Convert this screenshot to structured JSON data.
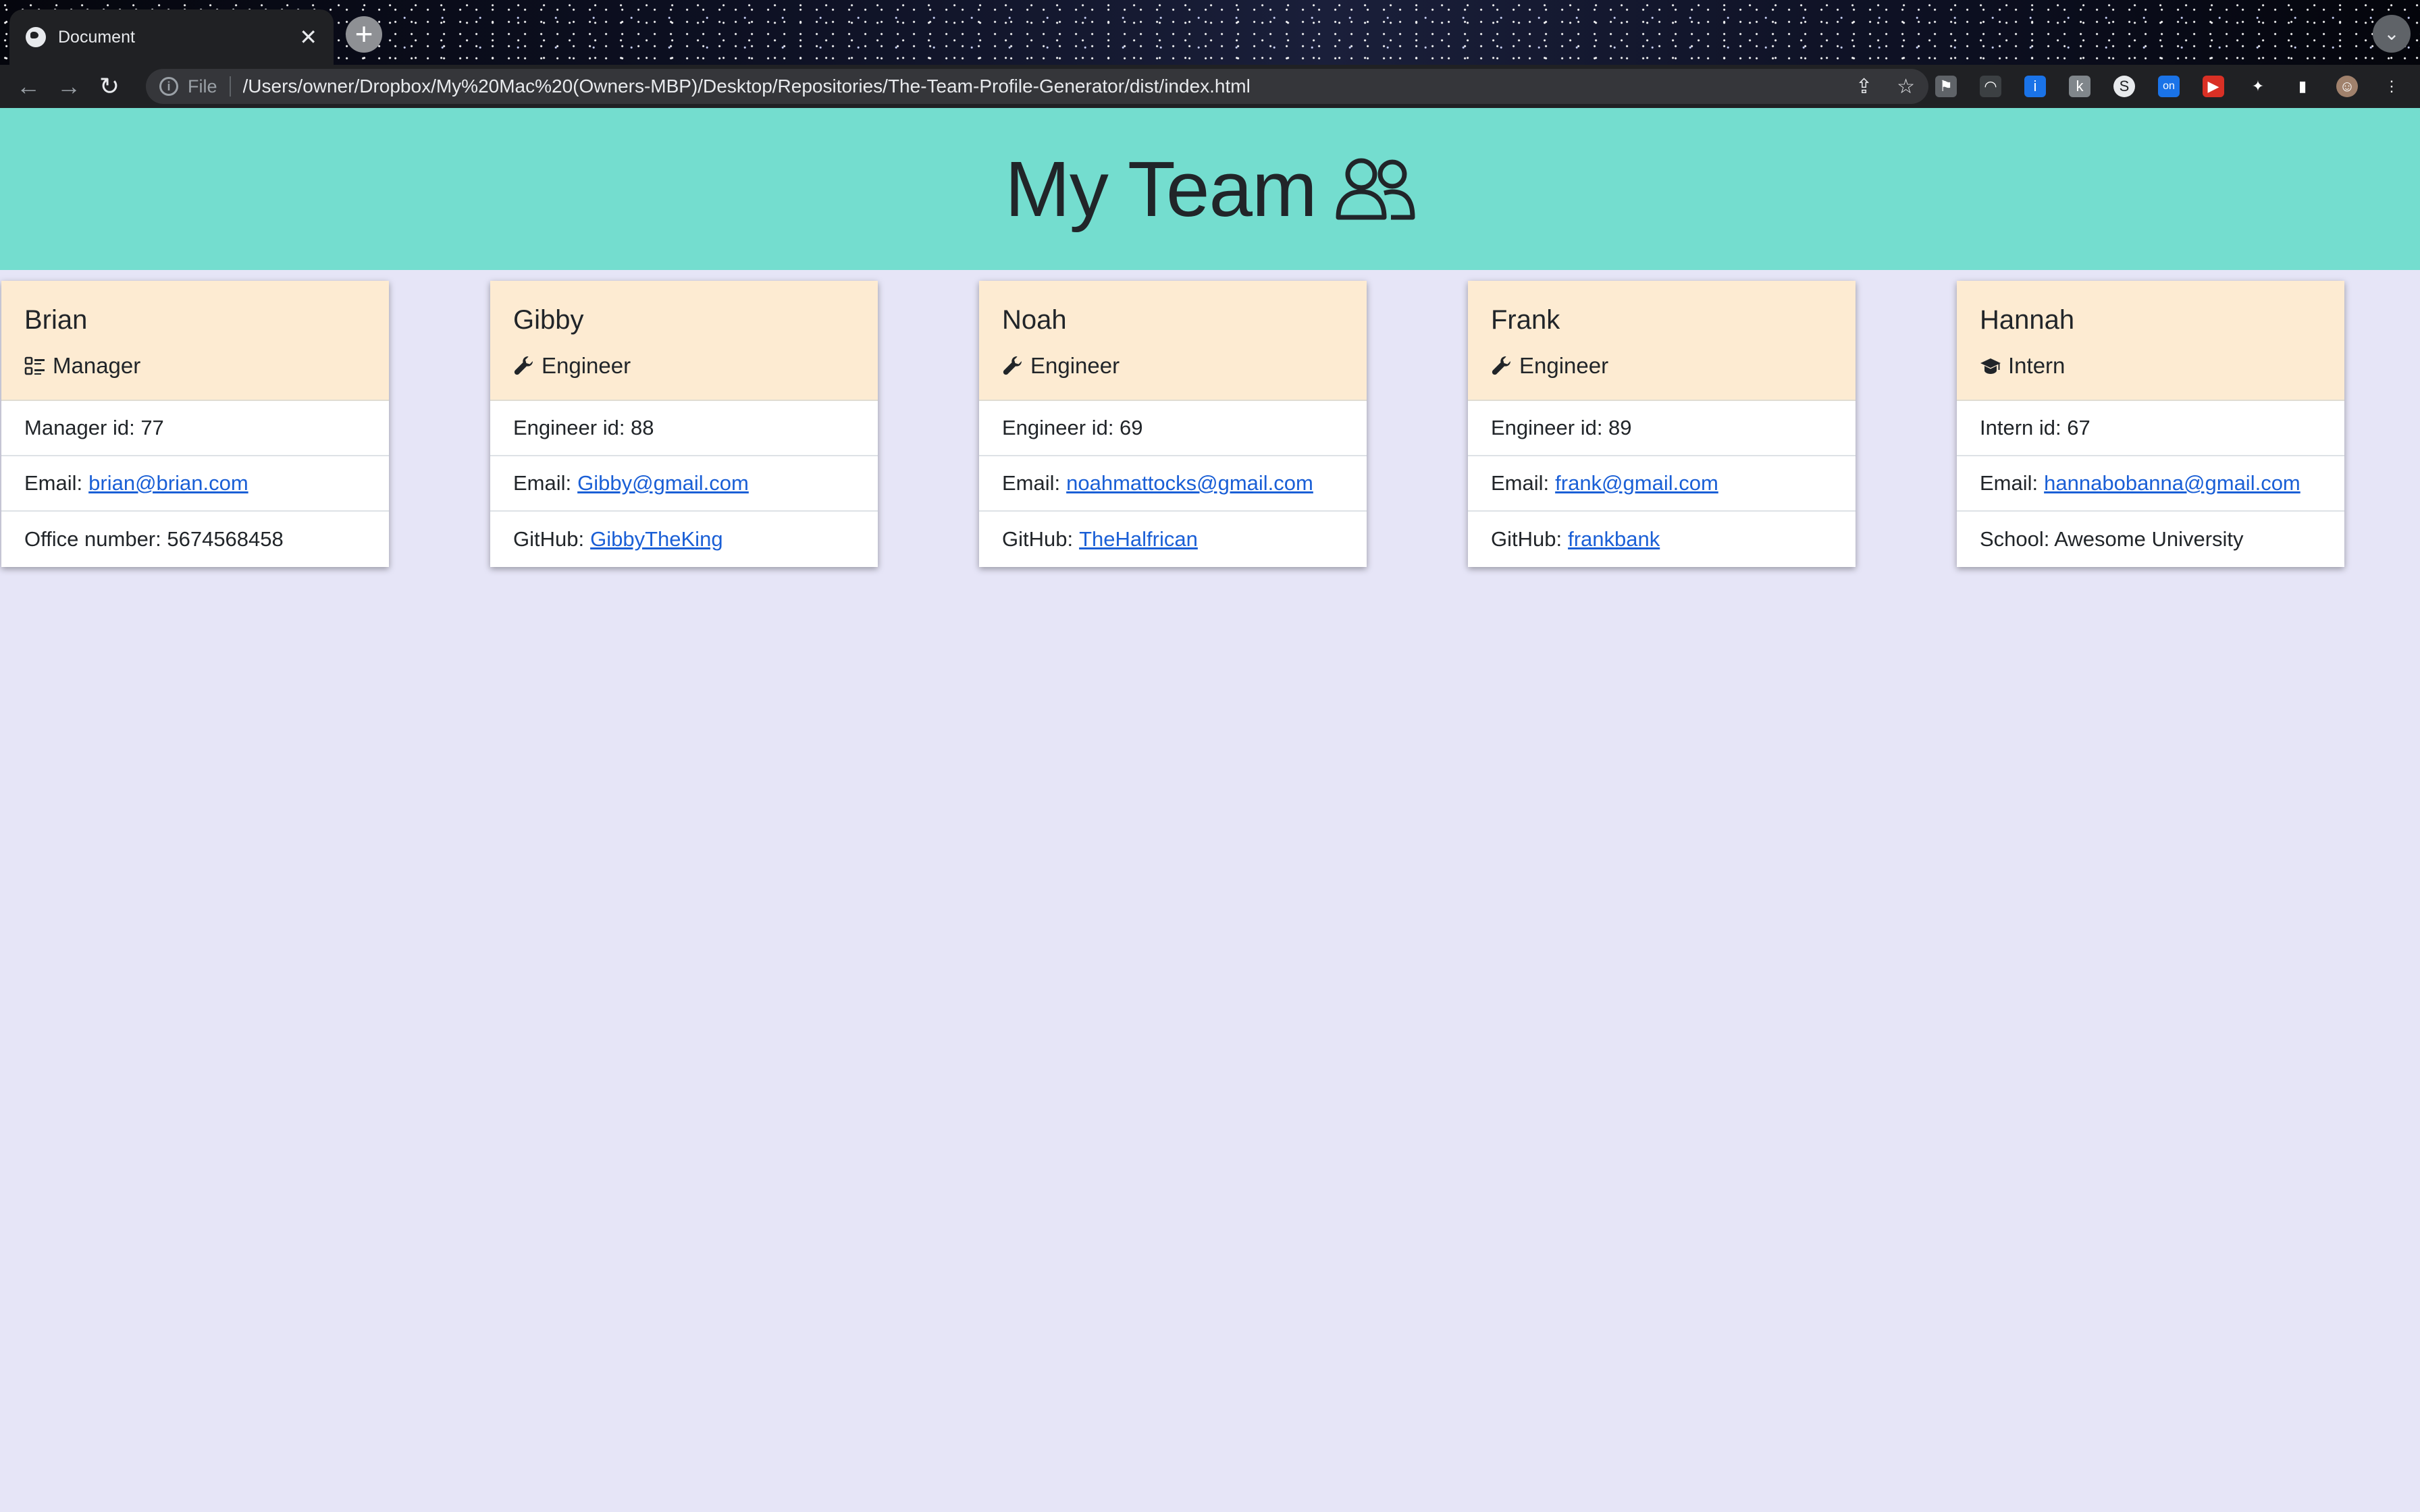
{
  "browser": {
    "tab_title": "Document",
    "scheme_label": "File",
    "url": "/Users/owner/Dropbox/My%20Mac%20(Owners-MBP)/Desktop/Repositories/The-Team-Profile-Generator/dist/index.html",
    "new_tab_symbol": "+",
    "close_symbol": "✕"
  },
  "header": {
    "title": "My Team",
    "icon": "people-icon"
  },
  "colors": {
    "banner": "#74ddcf",
    "card_header": "#fdebd2",
    "page_bg": "#e6e5f7",
    "link": "#1a5fd6"
  },
  "team": [
    {
      "name": "Brian",
      "role": "Manager",
      "role_icon": "list-check-icon",
      "id_label": "Manager id: 77",
      "email_label": "Email:",
      "email": "brian@brian.com",
      "extra_label": "Office number: 5674568458",
      "extra_link": ""
    },
    {
      "name": "Gibby",
      "role": "Engineer",
      "role_icon": "wrench-icon",
      "id_label": "Engineer id: 88",
      "email_label": "Email:",
      "email": "Gibby@gmail.com",
      "extra_label": "GitHub:",
      "extra_link": "GibbyTheKing"
    },
    {
      "name": "Noah",
      "role": "Engineer",
      "role_icon": "wrench-icon",
      "id_label": "Engineer id: 69",
      "email_label": "Email:",
      "email": "noahmattocks@gmail.com",
      "extra_label": "GitHub:",
      "extra_link": "TheHalfrican"
    },
    {
      "name": "Frank",
      "role": "Engineer",
      "role_icon": "wrench-icon",
      "id_label": "Engineer id: 89",
      "email_label": "Email:",
      "email": "frank@gmail.com",
      "extra_label": "GitHub:",
      "extra_link": "frankbank"
    },
    {
      "name": "Hannah",
      "role": "Intern",
      "role_icon": "graduation-cap-icon",
      "id_label": "Intern id: 67",
      "email_label": "Email:",
      "email": "hannabobanna@gmail.com",
      "extra_label": "School: Awesome University",
      "extra_link": ""
    }
  ]
}
